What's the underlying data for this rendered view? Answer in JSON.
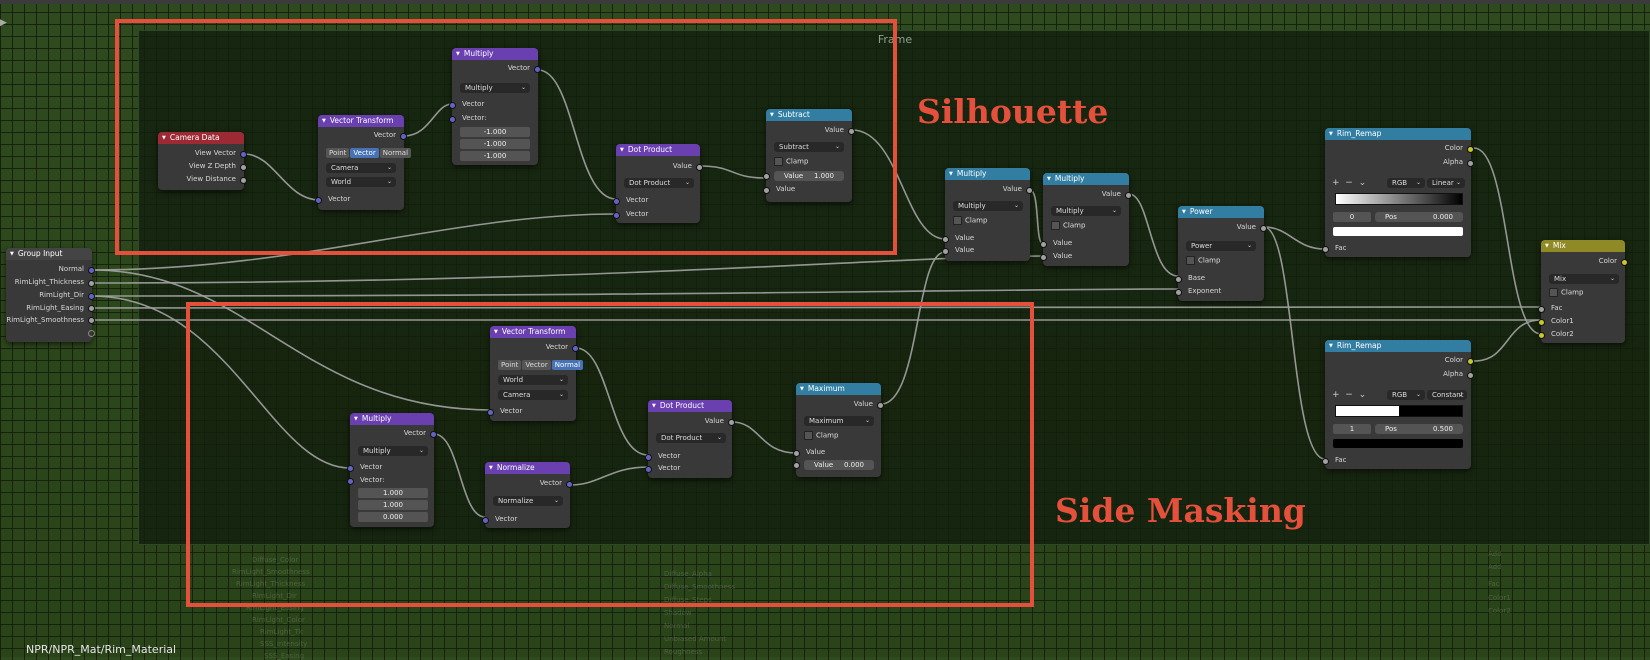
{
  "editor": {
    "frame_label": "Frame",
    "breadcrumb": "NPR/NPR_Mat/Rim_Material"
  },
  "annotations": {
    "silhouette": "Silhouette",
    "side_masking": "Side Masking"
  },
  "colors": {
    "annotation": "#e4503b",
    "vector_socket": "#6363c7",
    "float_socket": "#a1a1a1",
    "color_socket": "#c7c729"
  },
  "nodes": {
    "group_input": {
      "title": "Group Input",
      "outputs": [
        "Normal",
        "RimLight_Thickness",
        "RimLight_Dir",
        "RimLight_Easing",
        "RimLight_Smoothness"
      ]
    },
    "camera_data": {
      "title": "Camera Data",
      "outputs": [
        "View Vector",
        "View Z Depth",
        "View Distance"
      ]
    },
    "vt1": {
      "title": "Vector Transform",
      "output": "Vector",
      "toggle": [
        "Point",
        "Vector",
        "Normal"
      ],
      "from": "Camera",
      "to": "World",
      "input": "Vector"
    },
    "mul1": {
      "title": "Multiply",
      "output": "Vector",
      "op": "Multiply",
      "in1": "Vector",
      "in2": "Vector:",
      "values": [
        "-1.000",
        "-1.000",
        "-1.000"
      ]
    },
    "dot1": {
      "title": "Dot Product",
      "output": "Value",
      "op": "Dot Product",
      "in1": "Vector",
      "in2": "Vector"
    },
    "sub": {
      "title": "Subtract",
      "output": "Value",
      "op": "Subtract",
      "clamp": "Clamp",
      "field_label": "Value",
      "field_value": "1.000",
      "input": "Value"
    },
    "mul2": {
      "title": "Multiply",
      "output": "Value",
      "op": "Multiply",
      "clamp": "Clamp",
      "in1": "Value",
      "in2": "Value"
    },
    "mul3": {
      "title": "Multiply",
      "output": "Value",
      "op": "Multiply",
      "clamp": "Clamp",
      "in1": "Value",
      "in2": "Value"
    },
    "power": {
      "title": "Power",
      "output": "Value",
      "op": "Power",
      "clamp": "Clamp",
      "in1": "Base",
      "in2": "Exponent"
    },
    "ramp1": {
      "title": "Rim_Remap",
      "out1": "Color",
      "out2": "Alpha",
      "mode": "RGB",
      "interp": "Linear",
      "idx": "0",
      "pos_label": "Pos",
      "pos": "0.000",
      "input": "Fac",
      "plus": "+",
      "minus": "−",
      "chev": "⌄"
    },
    "ramp2": {
      "title": "Rim_Remap",
      "out1": "Color",
      "out2": "Alpha",
      "mode": "RGB",
      "interp": "Constant",
      "idx": "1",
      "pos_label": "Pos",
      "pos": "0.500",
      "input": "Fac",
      "plus": "+",
      "minus": "−",
      "chev": "⌄"
    },
    "mix": {
      "title": "Mix",
      "output": "Color",
      "op": "Mix",
      "clamp": "Clamp",
      "in1": "Fac",
      "in2": "Color1",
      "in3": "Color2"
    },
    "vt2": {
      "title": "Vector Transform",
      "output": "Vector",
      "toggle": [
        "Point",
        "Vector",
        "Normal"
      ],
      "from": "World",
      "to": "Camera",
      "input": "Vector"
    },
    "mul4": {
      "title": "Multiply",
      "output": "Vector",
      "op": "Multiply",
      "in1": "Vector",
      "in2": "Vector:",
      "values": [
        "1.000",
        "1.000",
        "0.000"
      ]
    },
    "norm": {
      "title": "Normalize",
      "output": "Vector",
      "op": "Normalize",
      "input": "Vector"
    },
    "dot2": {
      "title": "Dot Product",
      "output": "Value",
      "op": "Dot Product",
      "in1": "Vector",
      "in2": "Vector"
    },
    "max": {
      "title": "Maximum",
      "output": "Value",
      "op": "Maximum",
      "clamp": "Clamp",
      "in1": "Value",
      "field_label": "Value",
      "field_value": "0.000"
    }
  },
  "ghost": {
    "left": [
      "Diffuse_Color",
      "RimLight_Smoothness",
      "RimLight_Thickness",
      "RimLight_Dir",
      "RimLight_Easing",
      "RimLight_Color",
      "RimLight_Tk",
      "SSS_Intensity",
      "SSS_Easing"
    ],
    "mid": [
      "Diffuse_Alpha",
      "Diffuse_Smoothness",
      "Diffuse_Steps",
      "Shadow",
      "Normal",
      "Unbiased Amount",
      "Roughness"
    ],
    "right": [
      "Add",
      "Add",
      "Fac",
      "Color1",
      "Color2"
    ]
  }
}
